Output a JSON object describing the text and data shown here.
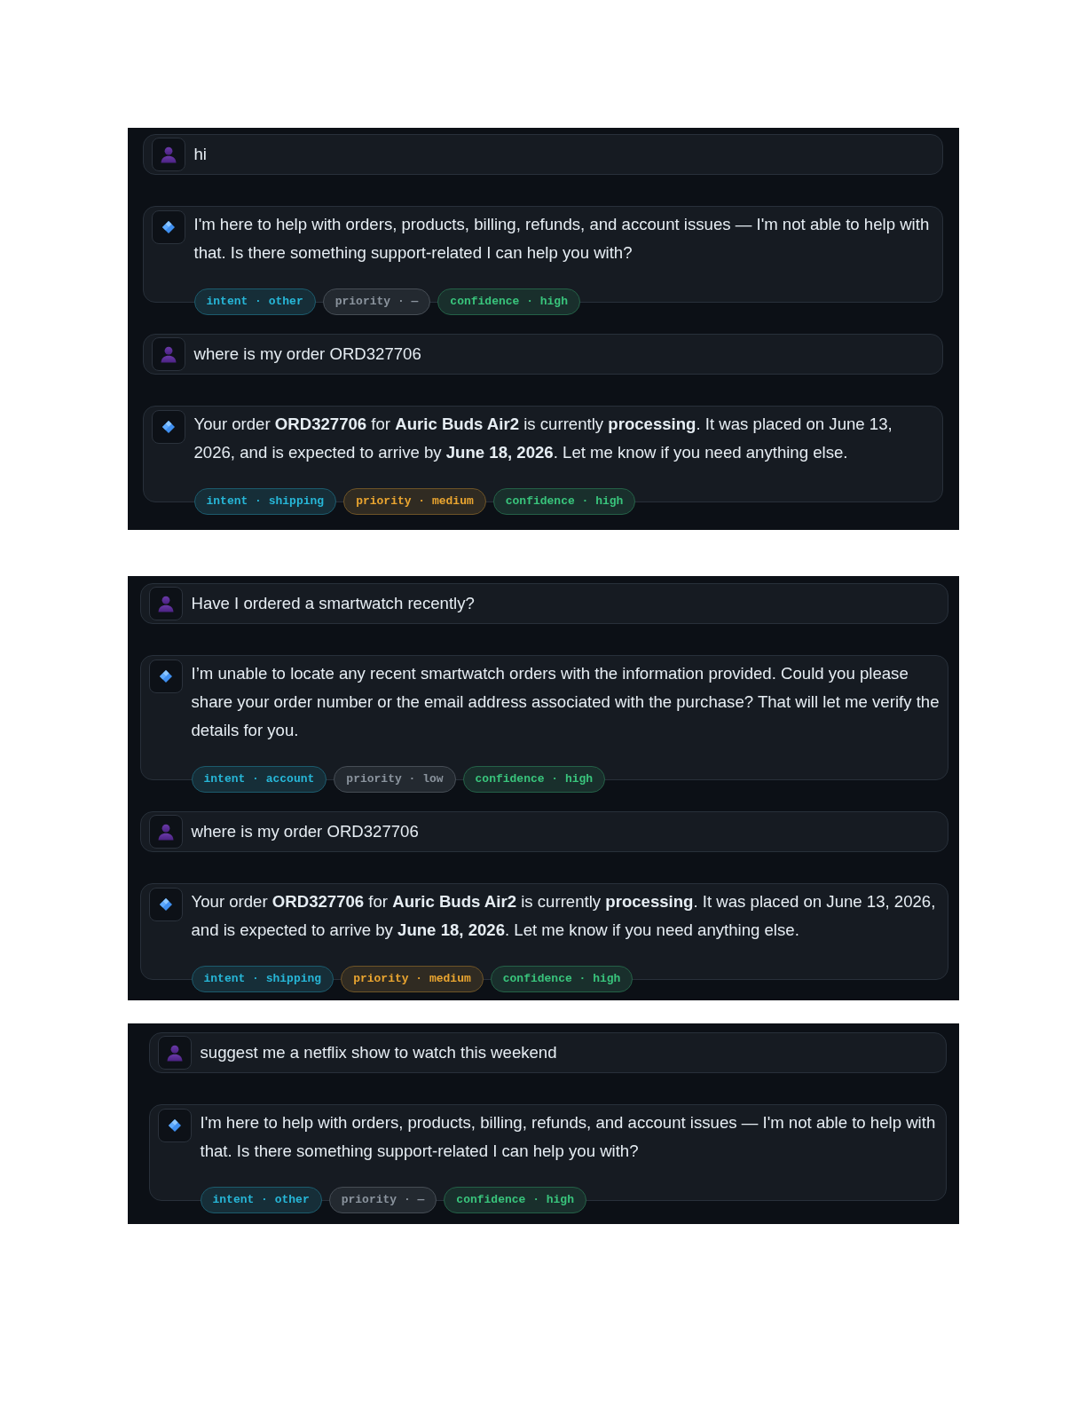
{
  "panels": [
    {
      "messages": [
        {
          "kind": "user",
          "text": "hi"
        },
        {
          "kind": "assistant",
          "text": "I'm here to help with orders, products, billing, refunds, and account issues — I'm not able to help with that. Is there something support-related I can help you with?",
          "tags": [
            {
              "text": "intent · other",
              "color": "#27b7d8"
            },
            {
              "text": "priority · —",
              "color": "#8b949e"
            },
            {
              "text": "confidence · high",
              "color": "#39c47c"
            }
          ]
        },
        {
          "kind": "user",
          "text": "where is my order ORD327706"
        },
        {
          "kind": "assistant",
          "text": "Your order **ORD327706** for **Auric Buds Air2** is currently **processing**. It was placed on June 13, 2026, and is expected to arrive by **June 18, 2026**. Let me know if you need anything else.",
          "tags": [
            {
              "text": "intent · shipping",
              "color": "#27b7d8"
            },
            {
              "text": "priority · medium",
              "color": "#eaa530"
            },
            {
              "text": "confidence · high",
              "color": "#39c47c"
            }
          ]
        }
      ]
    },
    {
      "messages": [
        {
          "kind": "user",
          "text": "Have I ordered a smartwatch recently?"
        },
        {
          "kind": "assistant",
          "text": "I’m unable to locate any recent smartwatch orders with the information provided. Could you please share your order number or the email address associated with the purchase? That will let me verify the details for you.",
          "tags": [
            {
              "text": "intent · account",
              "color": "#27b7d8"
            },
            {
              "text": "priority · low",
              "color": "#8b949e"
            },
            {
              "text": "confidence · high",
              "color": "#39c47c"
            }
          ]
        },
        {
          "kind": "user",
          "text": "where is my order ORD327706"
        },
        {
          "kind": "assistant",
          "text": "Your order **ORD327706** for **Auric Buds Air2** is currently **processing**. It was placed on June 13, 2026, and is expected to arrive by **June 18, 2026**. Let me know if you need anything else.",
          "tags": [
            {
              "text": "intent · shipping",
              "color": "#27b7d8"
            },
            {
              "text": "priority · medium",
              "color": "#eaa530"
            },
            {
              "text": "confidence · high",
              "color": "#39c47c"
            }
          ]
        }
      ]
    },
    {
      "messages": [
        {
          "kind": "user",
          "text": "suggest me a netflix show to watch this weekend"
        },
        {
          "kind": "assistant",
          "text": "I'm here to help with orders, products, billing, refunds, and account issues — I'm not able to help with that. Is there something support-related I can help you with?",
          "tags": [
            {
              "text": "intent · other",
              "color": "#27b7d8"
            },
            {
              "text": "priority · —",
              "color": "#8b949e"
            },
            {
              "text": "confidence · high",
              "color": "#39c47c"
            }
          ]
        }
      ]
    }
  ]
}
